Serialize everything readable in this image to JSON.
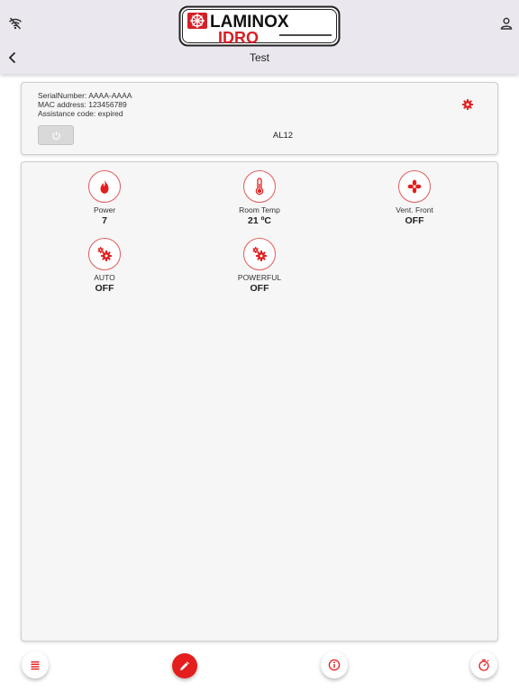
{
  "header": {
    "logo_top": "LAMINOX",
    "logo_bottom": "IDRO",
    "title": "Test"
  },
  "device": {
    "serial_line": "SerialNumber: AAAA-AAAA",
    "mac_line": "MAC address: 123456789",
    "assistance_line": "Assistance code: expired",
    "name": "AL12"
  },
  "tiles": [
    {
      "label": "Power",
      "value": "7",
      "icon": "flame-icon"
    },
    {
      "label": "Room Temp",
      "value": "21 ºC",
      "icon": "thermometer-icon"
    },
    {
      "label": "Vent. Front",
      "value": "OFF",
      "icon": "fan-icon"
    },
    {
      "label": "AUTO",
      "value": "OFF",
      "icon": "gears-icon"
    },
    {
      "label": "POWERFUL",
      "value": "OFF",
      "icon": "gears-icon"
    }
  ],
  "bottom_bar": [
    "list-icon",
    "edit-icon",
    "info-icon",
    "timer-icon"
  ],
  "colors": {
    "accent": "#e41d1d",
    "appbar": "#ebe7ef",
    "card": "#f6f6f6"
  }
}
